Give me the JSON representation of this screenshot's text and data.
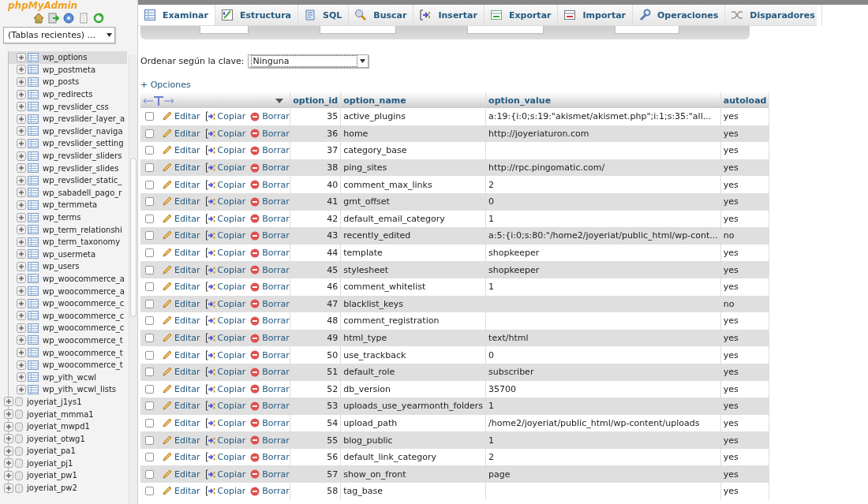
{
  "sidebar": {
    "logo": "phpMyAdmin",
    "recent_tables": {
      "value": "(Tablas recientes) ..."
    },
    "tables": [
      {
        "name": "wp_options",
        "selected": true
      },
      {
        "name": "wp_postmeta",
        "selected": false
      },
      {
        "name": "wp_posts",
        "selected": false
      },
      {
        "name": "wp_redirects",
        "selected": false
      },
      {
        "name": "wp_revslider_css",
        "selected": false
      },
      {
        "name": "wp_revslider_layer_a",
        "selected": false
      },
      {
        "name": "wp_revslider_naviga",
        "selected": false
      },
      {
        "name": "wp_revslider_setting",
        "selected": false
      },
      {
        "name": "wp_revslider_sliders",
        "selected": false
      },
      {
        "name": "wp_revslider_slides",
        "selected": false
      },
      {
        "name": "wp_revslider_static_",
        "selected": false
      },
      {
        "name": "wp_sabadell_pago_r",
        "selected": false
      },
      {
        "name": "wp_termmeta",
        "selected": false
      },
      {
        "name": "wp_terms",
        "selected": false
      },
      {
        "name": "wp_term_relationshi",
        "selected": false
      },
      {
        "name": "wp_term_taxonomy",
        "selected": false
      },
      {
        "name": "wp_usermeta",
        "selected": false
      },
      {
        "name": "wp_users",
        "selected": false
      },
      {
        "name": "wp_woocommerce_a",
        "selected": false
      },
      {
        "name": "wp_woocommerce_a",
        "selected": false
      },
      {
        "name": "wp_woocommerce_c",
        "selected": false
      },
      {
        "name": "wp_woocommerce_c",
        "selected": false
      },
      {
        "name": "wp_woocommerce_c",
        "selected": false
      },
      {
        "name": "wp_woocommerce_t",
        "selected": false
      },
      {
        "name": "wp_woocommerce_t",
        "selected": false
      },
      {
        "name": "wp_woocommerce_t",
        "selected": false
      },
      {
        "name": "wp_yith_wcwl",
        "selected": false
      },
      {
        "name": "wp_yith_wcwl_lists",
        "selected": false
      }
    ],
    "databases": [
      "joyeriat_j1ys1",
      "joyeriat_mmma1",
      "joyeriat_mwpd1",
      "joyeriat_otwg1",
      "joyeriat_pa1",
      "joyeriat_pj1",
      "joyeriat_pw1",
      "joyeriat_pw2"
    ]
  },
  "tabs": [
    {
      "label": "Examinar",
      "selected": true
    },
    {
      "label": "Estructura",
      "selected": false
    },
    {
      "label": "SQL",
      "selected": false
    },
    {
      "label": "Buscar",
      "selected": false
    },
    {
      "label": "Insertar",
      "selected": false
    },
    {
      "label": "Exportar",
      "selected": false
    },
    {
      "label": "Importar",
      "selected": false
    },
    {
      "label": "Operaciones",
      "selected": false
    },
    {
      "label": "Disparadores",
      "selected": false
    }
  ],
  "sort": {
    "label": "Ordenar según la clave:",
    "value": "Ninguna"
  },
  "options_link": "+ Opciones",
  "table": {
    "columns": [
      "option_id",
      "option_name",
      "option_value",
      "autoload"
    ],
    "rows": [
      {
        "checked": false,
        "actions": [
          "Editar",
          "Copiar",
          "Borrar"
        ],
        "cells": [
          "35",
          "active_plugins",
          "a:19:{i:0;s:19:\"akismet/akismet.php\";i:1;s:35:\"all...",
          "yes"
        ]
      },
      {
        "checked": false,
        "actions": [
          "Editar",
          "Copiar",
          "Borrar"
        ],
        "cells": [
          "36",
          "home",
          "http://joyeriaturon.com",
          "yes"
        ]
      },
      {
        "checked": false,
        "actions": [
          "Editar",
          "Copiar",
          "Borrar"
        ],
        "cells": [
          "37",
          "category_base",
          "",
          "yes"
        ]
      },
      {
        "checked": false,
        "actions": [
          "Editar",
          "Copiar",
          "Borrar"
        ],
        "cells": [
          "38",
          "ping_sites",
          "http://rpc.pingomatic.com/",
          "yes"
        ]
      },
      {
        "checked": false,
        "actions": [
          "Editar",
          "Copiar",
          "Borrar"
        ],
        "cells": [
          "40",
          "comment_max_links",
          "2",
          "yes"
        ]
      },
      {
        "checked": false,
        "actions": [
          "Editar",
          "Copiar",
          "Borrar"
        ],
        "cells": [
          "41",
          "gmt_offset",
          "0",
          "yes"
        ]
      },
      {
        "checked": false,
        "actions": [
          "Editar",
          "Copiar",
          "Borrar"
        ],
        "cells": [
          "42",
          "default_email_category",
          "1",
          "yes"
        ]
      },
      {
        "checked": false,
        "actions": [
          "Editar",
          "Copiar",
          "Borrar"
        ],
        "cells": [
          "43",
          "recently_edited",
          "a:5:{i:0;s:80:\"/home2/joyeriat/public_html/wp-cont...",
          "no"
        ]
      },
      {
        "checked": false,
        "actions": [
          "Editar",
          "Copiar",
          "Borrar"
        ],
        "cells": [
          "44",
          "template",
          "shopkeeper",
          "yes"
        ]
      },
      {
        "checked": false,
        "actions": [
          "Editar",
          "Copiar",
          "Borrar"
        ],
        "cells": [
          "45",
          "stylesheet",
          "shopkeeper",
          "yes"
        ]
      },
      {
        "checked": false,
        "actions": [
          "Editar",
          "Copiar",
          "Borrar"
        ],
        "cells": [
          "46",
          "comment_whitelist",
          "1",
          "yes"
        ]
      },
      {
        "checked": false,
        "actions": [
          "Editar",
          "Copiar",
          "Borrar"
        ],
        "cells": [
          "47",
          "blacklist_keys",
          "",
          "no"
        ]
      },
      {
        "checked": false,
        "actions": [
          "Editar",
          "Copiar",
          "Borrar"
        ],
        "cells": [
          "48",
          "comment_registration",
          "",
          "yes"
        ]
      },
      {
        "checked": false,
        "actions": [
          "Editar",
          "Copiar",
          "Borrar"
        ],
        "cells": [
          "49",
          "html_type",
          "text/html",
          "yes"
        ]
      },
      {
        "checked": false,
        "actions": [
          "Editar",
          "Copiar",
          "Borrar"
        ],
        "cells": [
          "50",
          "use_trackback",
          "0",
          "yes"
        ]
      },
      {
        "checked": false,
        "actions": [
          "Editar",
          "Copiar",
          "Borrar"
        ],
        "cells": [
          "51",
          "default_role",
          "subscriber",
          "yes"
        ]
      },
      {
        "checked": false,
        "actions": [
          "Editar",
          "Copiar",
          "Borrar"
        ],
        "cells": [
          "52",
          "db_version",
          "35700",
          "yes"
        ]
      },
      {
        "checked": false,
        "actions": [
          "Editar",
          "Copiar",
          "Borrar"
        ],
        "cells": [
          "53",
          "uploads_use_yearmonth_folders",
          "1",
          "yes"
        ]
      },
      {
        "checked": false,
        "actions": [
          "Editar",
          "Copiar",
          "Borrar"
        ],
        "cells": [
          "54",
          "upload_path",
          "/home2/joyeriat/public_html/wp-content/uploads",
          "yes"
        ]
      },
      {
        "checked": false,
        "actions": [
          "Editar",
          "Copiar",
          "Borrar"
        ],
        "cells": [
          "55",
          "blog_public",
          "1",
          "yes"
        ]
      },
      {
        "checked": false,
        "actions": [
          "Editar",
          "Copiar",
          "Borrar"
        ],
        "cells": [
          "56",
          "default_link_category",
          "2",
          "yes"
        ]
      },
      {
        "checked": false,
        "actions": [
          "Editar",
          "Copiar",
          "Borrar"
        ],
        "cells": [
          "57",
          "show_on_front",
          "page",
          "yes"
        ]
      },
      {
        "checked": false,
        "actions": [
          "Editar",
          "Copiar",
          "Borrar"
        ],
        "cells": [
          "58",
          "tag_base",
          "",
          "yes"
        ]
      }
    ]
  }
}
